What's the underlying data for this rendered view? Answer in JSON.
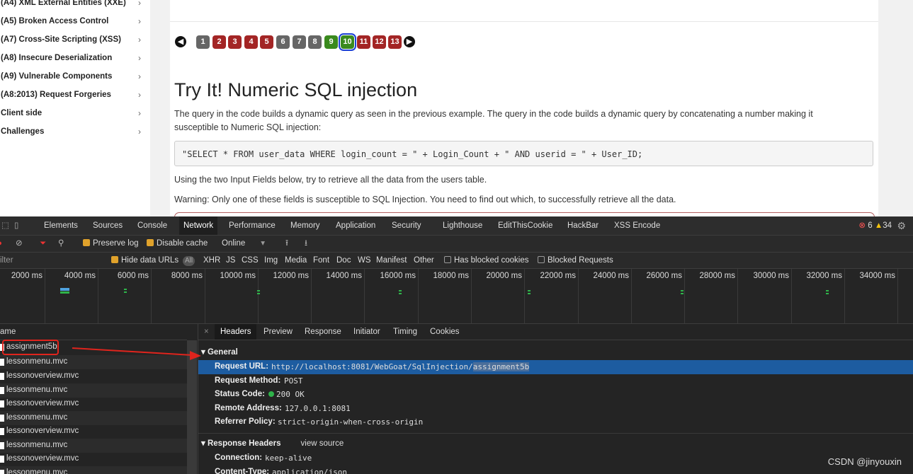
{
  "sidebar": {
    "items": [
      {
        "label": "(A4) XML External Entities (XXE)"
      },
      {
        "label": "(A5) Broken Access Control"
      },
      {
        "label": "(A7) Cross-Site Scripting (XSS)"
      },
      {
        "label": "(A8) Insecure Deserialization"
      },
      {
        "label": "(A9) Vulnerable Components"
      },
      {
        "label": "(A8:2013) Request Forgeries"
      },
      {
        "label": "Client side"
      },
      {
        "label": "Challenges"
      }
    ],
    "chevron": "›"
  },
  "pager": {
    "pages": [
      {
        "num": "1",
        "state": "gray"
      },
      {
        "num": "2",
        "state": "red"
      },
      {
        "num": "3",
        "state": "red"
      },
      {
        "num": "4",
        "state": "red"
      },
      {
        "num": "5",
        "state": "red"
      },
      {
        "num": "6",
        "state": "gray"
      },
      {
        "num": "7",
        "state": "gray"
      },
      {
        "num": "8",
        "state": "gray"
      },
      {
        "num": "9",
        "state": "green"
      },
      {
        "num": "10",
        "state": "current"
      },
      {
        "num": "11",
        "state": "red"
      },
      {
        "num": "12",
        "state": "red"
      },
      {
        "num": "13",
        "state": "red"
      }
    ],
    "prev_icon": "arrow-left-icon",
    "next_icon": "arrow-right-icon"
  },
  "lesson": {
    "title": "Try It! Numeric SQL injection",
    "intro_line1": "The query in the code builds a dynamic query as seen in the previous example. The query in the code builds a dynamic query by concatenating a number making it",
    "intro_line2": "susceptible to Numeric SQL injection:",
    "code": "\"SELECT * FROM user_data WHERE login_count = \" + Login_Count + \" AND userid = \"  + User_ID;",
    "instruction": "Using the two Input Fields below, try to retrieve all the data from the users table.",
    "warning": "Warning: Only one of these fields is susceptible to SQL Injection. You need to find out which, to successfully retrieve all the data."
  },
  "devtools": {
    "tabs": [
      "Elements",
      "Sources",
      "Console",
      "Network",
      "Performance",
      "Memory",
      "Application",
      "Security",
      "Lighthouse",
      "EditThisCookie",
      "HackBar",
      "XSS Encode"
    ],
    "active_tab": "Network",
    "error_count": "6",
    "warning_count": "34",
    "toolbar": {
      "preserve_log": "Preserve log",
      "disable_cache": "Disable cache",
      "throttle": "Online"
    },
    "filter": {
      "placeholder": "ilter",
      "hide_data_urls": "Hide data URLs",
      "all": "All",
      "types": [
        "XHR",
        "JS",
        "CSS",
        "Img",
        "Media",
        "Font",
        "Doc",
        "WS",
        "Manifest",
        "Other"
      ],
      "has_blocked_cookies": "Has blocked cookies",
      "blocked_requests": "Blocked Requests"
    },
    "timeline_ticks": [
      "2000 ms",
      "4000 ms",
      "6000 ms",
      "8000 ms",
      "10000 ms",
      "12000 ms",
      "14000 ms",
      "16000 ms",
      "18000 ms",
      "20000 ms",
      "22000 ms",
      "24000 ms",
      "26000 ms",
      "28000 ms",
      "30000 ms",
      "32000 ms",
      "34000 ms"
    ],
    "requests": {
      "header": "ame",
      "rows": [
        "assignment5b",
        "lessonmenu.mvc",
        "lessonoverview.mvc",
        "lessonmenu.mvc",
        "lessonoverview.mvc",
        "lessonmenu.mvc",
        "lessonoverview.mvc",
        "lessonmenu.mvc",
        "lessonoverview.mvc",
        "lessonmenu.mvc"
      ]
    },
    "detail_tabs": [
      "Headers",
      "Preview",
      "Response",
      "Initiator",
      "Timing",
      "Cookies"
    ],
    "active_detail_tab": "Headers",
    "general": {
      "section": "General",
      "request_url_key": "Request URL:",
      "request_url_prefix": "http://localhost:8081/WebGoat/SqlInjection/",
      "request_url_highlight": "assignment5b",
      "request_method_key": "Request Method:",
      "request_method": "POST",
      "status_code_key": "Status Code:",
      "status_code": "200 OK",
      "remote_address_key": "Remote Address:",
      "remote_address": "127.0.0.1:8081",
      "referrer_policy_key": "Referrer Policy:",
      "referrer_policy": "strict-origin-when-cross-origin"
    },
    "response_headers": {
      "section": "Response Headers",
      "view_source": "view source",
      "connection_key": "Connection:",
      "connection": "keep-alive",
      "content_type_key": "Content-Type:",
      "content_type": "application/json"
    }
  },
  "watermark": "CSDN @jinyouxin",
  "colors": {
    "annotation": "#e0241d",
    "selected_row": "#1d5ca0"
  }
}
